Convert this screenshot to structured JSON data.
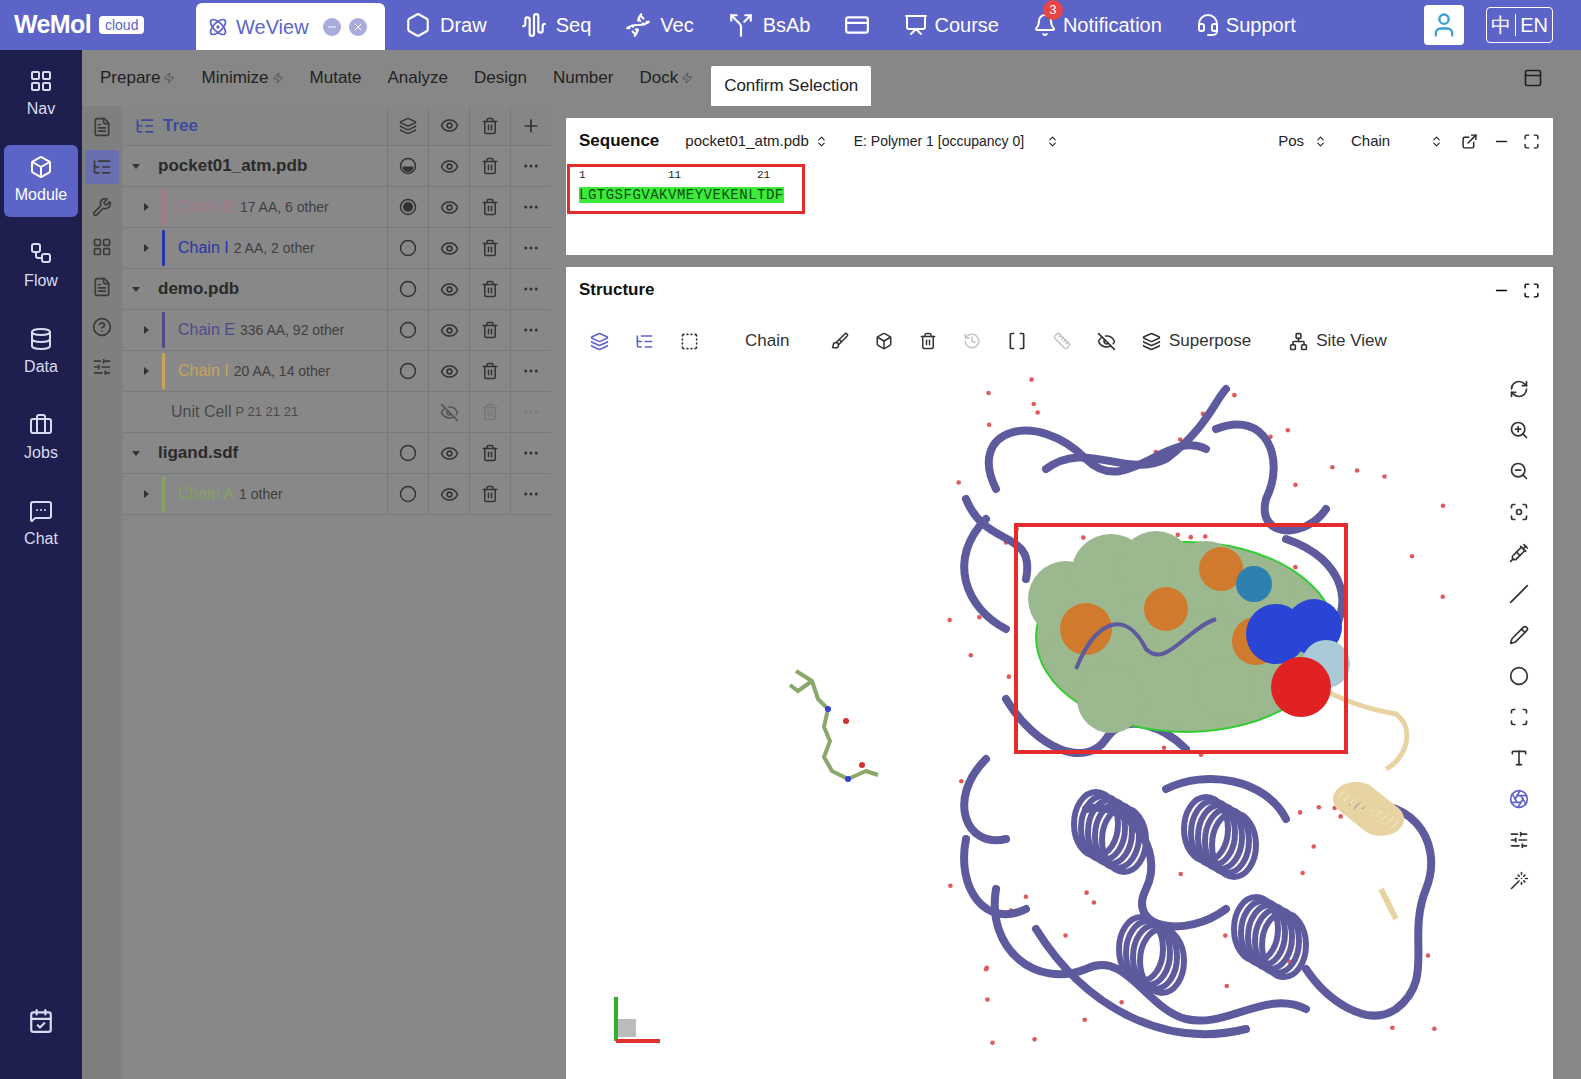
{
  "topbar": {
    "logo": "WeMol",
    "badge": "cloud",
    "tab": {
      "label": "WeView",
      "selected": true
    },
    "nav": [
      {
        "label": "Draw"
      },
      {
        "label": "Seq"
      },
      {
        "label": "Vec"
      },
      {
        "label": "BsAb"
      }
    ],
    "nav_right": [
      {
        "label": "Course",
        "badge": null
      },
      {
        "label": "Notification",
        "badge": "3"
      },
      {
        "label": "Support",
        "badge": null
      }
    ],
    "language": [
      "中",
      "EN"
    ]
  },
  "sidebar": {
    "items": [
      {
        "label": "Nav",
        "selected": false
      },
      {
        "label": "Module",
        "selected": true
      },
      {
        "label": "Flow",
        "selected": false
      },
      {
        "label": "Data",
        "selected": false
      },
      {
        "label": "Jobs",
        "selected": false
      },
      {
        "label": "Chat",
        "selected": false
      }
    ]
  },
  "menu": {
    "items": [
      {
        "label": "Prepare",
        "powered": true
      },
      {
        "label": "Minimize",
        "powered": true
      },
      {
        "label": "Mutate",
        "powered": false
      },
      {
        "label": "Analyze",
        "powered": false
      },
      {
        "label": "Design",
        "powered": false
      },
      {
        "label": "Number",
        "powered": false
      },
      {
        "label": "Dock",
        "powered": true
      }
    ],
    "button": "Confirm Selection"
  },
  "tools": [
    {
      "selected": false
    },
    {
      "selected": true
    },
    {
      "selected": false
    },
    {
      "selected": false
    },
    {
      "selected": false
    },
    {
      "selected": false
    },
    {
      "selected": false
    }
  ],
  "tree": {
    "title": "Tree",
    "rows": [
      {
        "kind": "file",
        "label": "pocket01_atm.pdb",
        "detail": "",
        "color": "#2a2a2a",
        "radio": "partial",
        "visible": true,
        "expanded": true
      },
      {
        "kind": "chain",
        "label": "Chain E",
        "detail": "17 AA, 6 other",
        "color": "#a77790",
        "radio": "selected",
        "visible": true,
        "expanded": false
      },
      {
        "kind": "chain",
        "label": "Chain I",
        "detail": "2 AA, 2 other",
        "color": "#2536a8",
        "radio": "none",
        "visible": true,
        "expanded": false
      },
      {
        "kind": "file",
        "label": "demo.pdb",
        "detail": "",
        "color": "#2a2a2a",
        "radio": "none",
        "visible": true,
        "expanded": true
      },
      {
        "kind": "chain",
        "label": "Chain E",
        "detail": "336 AA, 92 other",
        "color": "#4e4c88",
        "radio": "none",
        "visible": true,
        "expanded": false
      },
      {
        "kind": "chain",
        "label": "Chain I",
        "detail": "20 AA, 14 other",
        "color": "#c9a45c",
        "radio": "none",
        "visible": true,
        "expanded": false
      },
      {
        "kind": "cell",
        "label": "Unit Cell",
        "detail": "P 21 21 21",
        "color": "#4a4a4a",
        "radio": null,
        "visible": false,
        "expanded": false
      },
      {
        "kind": "file",
        "label": "ligand.sdf",
        "detail": "",
        "color": "#2a2a2a",
        "radio": "none",
        "visible": true,
        "expanded": true
      },
      {
        "kind": "chain",
        "label": "Chain A",
        "detail": "1 other",
        "color": "#86a266",
        "radio": "none",
        "visible": true,
        "expanded": false
      }
    ]
  },
  "sequence": {
    "title": "Sequence",
    "file": "pocket01_atm.pdb",
    "chain": "E: Polymer 1 [occupancy 0]",
    "pos": "Pos",
    "chain_mode": "Chain",
    "ruler": [
      "1",
      "11",
      "21"
    ],
    "residues": "LGTGSFGVAKVMEYVEKENLTDF",
    "highlighted": true
  },
  "structure": {
    "title": "Structure",
    "toolbar": {
      "chain": "Chain",
      "superpose": "Superpose",
      "site_view": "Site View"
    }
  }
}
